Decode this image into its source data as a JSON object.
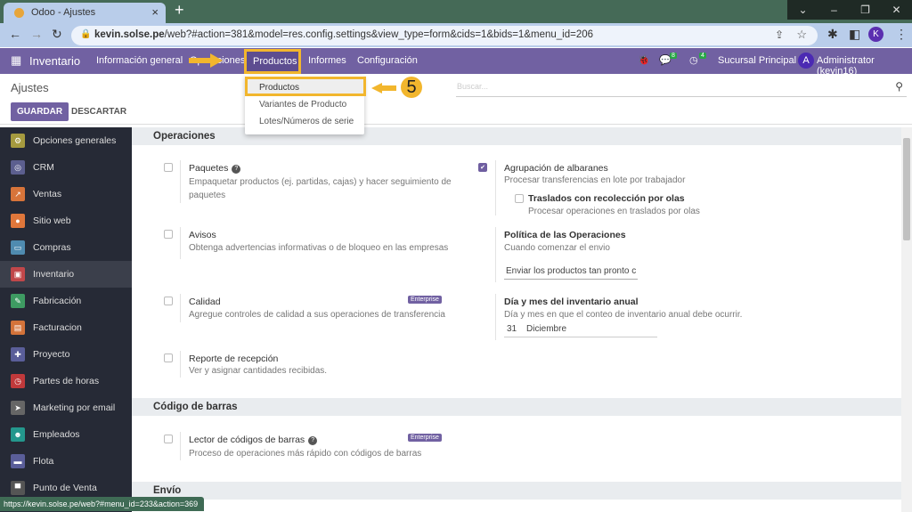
{
  "browser": {
    "tab_title": "Odoo - Ajustes",
    "url_domain": "kevin.solse.pe",
    "url_path": "/web?#action=381&model=res.config.settings&view_type=form&cids=1&bids=1&menu_id=206",
    "profile_initial": "K",
    "status_url": "https://kevin.solse.pe/web?#menu_id=233&action=369"
  },
  "navbar": {
    "app": "Inventario",
    "menu": [
      "Información general",
      "Operaciones",
      "Productos",
      "Informes",
      "Configuración"
    ],
    "messages_count": "8",
    "activities_count": "4",
    "company": "Sucursal Principal",
    "user_initial": "A",
    "user": "Administrator (kevin16)"
  },
  "dropdown": {
    "items": [
      "Productos",
      "Variantes de Producto",
      "Lotes/Números de serie"
    ]
  },
  "annotation": {
    "step": "5",
    "highlight_color": "#f2b62d"
  },
  "control_panel": {
    "breadcrumb": "Ajustes",
    "save": "GUARDAR",
    "discard": "DESCARTAR",
    "search_placeholder": "Buscar..."
  },
  "sidebar": {
    "items": [
      {
        "label": "Opciones generales",
        "color": "#a59a3f",
        "icon": "gear-icon"
      },
      {
        "label": "CRM",
        "color": "#5c5f8f",
        "icon": "crm-icon"
      },
      {
        "label": "Ventas",
        "color": "#d7743a",
        "icon": "chart-icon"
      },
      {
        "label": "Sitio web",
        "color": "#e0773b",
        "icon": "globe-icon"
      },
      {
        "label": "Compras",
        "color": "#4f8bb0",
        "icon": "card-icon"
      },
      {
        "label": "Inventario",
        "color": "#c0474a",
        "icon": "box-icon",
        "active": true
      },
      {
        "label": "Fabricación",
        "color": "#3e9b62",
        "icon": "wrench-icon"
      },
      {
        "label": "Facturacion",
        "color": "#d3733a",
        "icon": "invoice-icon"
      },
      {
        "label": "Proyecto",
        "color": "#5a5e99",
        "icon": "puzzle-icon"
      },
      {
        "label": "Partes de horas",
        "color": "#c0393b",
        "icon": "timer-icon"
      },
      {
        "label": "Marketing por email",
        "color": "#666",
        "icon": "paper-plane-icon"
      },
      {
        "label": "Empleados",
        "color": "#24978d",
        "icon": "people-icon"
      },
      {
        "label": "Flota",
        "color": "#5a5e99",
        "icon": "car-icon"
      },
      {
        "label": "Punto de Venta",
        "color": "#555",
        "icon": "store-icon"
      }
    ]
  },
  "sections": {
    "operaciones": {
      "title": "Operaciones",
      "paquetes": {
        "title": "Paquetes",
        "desc1": "Empaquetar productos (ej. partidas, cajas) y hacer seguimiento de",
        "desc2": "paquetes",
        "checked": false
      },
      "avisos": {
        "title": "Avisos",
        "desc": "Obtenga advertencias informativas o de bloqueo en las empresas",
        "checked": false
      },
      "calidad": {
        "title": "Calidad",
        "desc": "Agregue controles de calidad a sus operaciones de transferencia",
        "badge": "Enterprise",
        "checked": false
      },
      "reporte": {
        "title": "Reporte de recepción",
        "desc": "Ver y asignar cantidades recibidas.",
        "checked": false
      },
      "agrupacion": {
        "title": "Agrupación de albaranes",
        "desc": "Procesar transferencias en lote por trabajador",
        "checked": true
      },
      "olas": {
        "title": "Traslados con recolección por olas",
        "desc": "Procesar operaciones en traslados por olas",
        "checked": false
      },
      "politica": {
        "title": "Política de las Operaciones",
        "desc": "Cuando comenzar el envio",
        "value": "Enviar los productos tan pronto c"
      },
      "inventario_anual": {
        "title": "Día y mes del inventario anual",
        "desc": "Día y mes en que el conteo de inventario anual debe ocurrir.",
        "day": "31",
        "month": "Diciembre"
      }
    },
    "codigo": {
      "title": "Código de barras",
      "lector": {
        "title": "Lector de códigos de barras",
        "desc": "Proceso de operaciones más rápido con códigos de barras",
        "badge": "Enterprise",
        "checked": false
      }
    },
    "envio": {
      "title": "Envío"
    }
  }
}
